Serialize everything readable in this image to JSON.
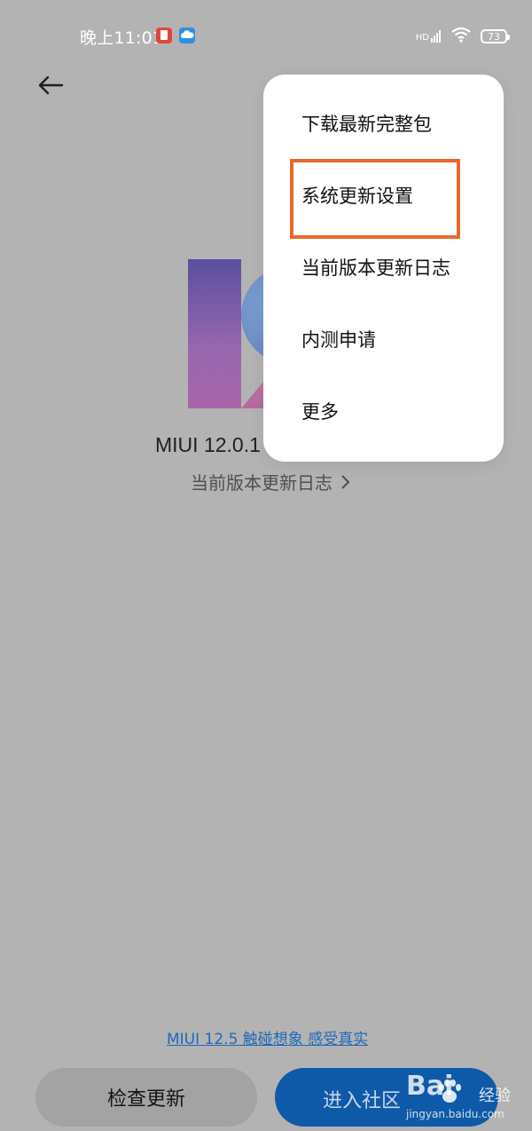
{
  "status_bar": {
    "time": "晚上11:01",
    "network_label": "HD",
    "battery": "73",
    "icons": [
      "red-app-icon",
      "cloud-icon",
      "signal-icon",
      "wifi-icon",
      "battery-icon"
    ]
  },
  "header": {
    "back_icon": "arrow-left-icon"
  },
  "main": {
    "version": "MIUI 12.0.1",
    "changelog_link": "当前版本更新日志",
    "promo_link": "MIUI 12.5 触碰想象 感受真实"
  },
  "buttons": {
    "check_update": "检查更新",
    "enter_community": "进入社区"
  },
  "menu": {
    "items": [
      {
        "label": "下载最新完整包"
      },
      {
        "label": "系统更新设置"
      },
      {
        "label": "当前版本更新日志"
      },
      {
        "label": "内测申请"
      },
      {
        "label": "更多"
      }
    ]
  },
  "annotation": {
    "highlight_color": "#e86a2b",
    "highlighted_item": "系统更新设置"
  },
  "watermark": {
    "brand": "Bai",
    "word": "经验",
    "url": "jingyan.baidu.com"
  },
  "colors": {
    "overlay_background": "#b3b3b3",
    "link_blue": "#1e6ab8",
    "community_button": "#0f5aa8"
  }
}
